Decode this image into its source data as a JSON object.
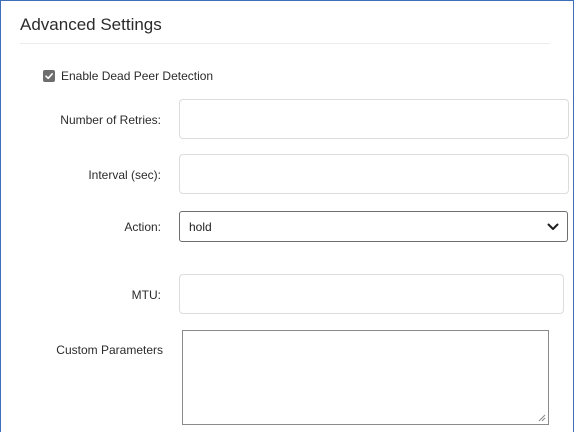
{
  "section": {
    "title": "Advanced Settings"
  },
  "dpd": {
    "label": "Enable Dead Peer Detection",
    "checked": true
  },
  "fields": {
    "retries": {
      "label": "Number of Retries:",
      "value": ""
    },
    "interval": {
      "label": "Interval (sec):",
      "value": ""
    },
    "action": {
      "label": "Action:",
      "value": "hold"
    },
    "mtu": {
      "label": "MTU:",
      "value": ""
    },
    "custom": {
      "label": "Custom Parameters",
      "value": ""
    }
  },
  "icons": {
    "checkbox": "check-icon",
    "select": "chevron-down-icon",
    "textarea": "resize-grip-icon"
  },
  "colors": {
    "panel_border": "#3f6fb8",
    "checkbox_fill": "#6d6d6d",
    "input_border": "#dcdcdc"
  }
}
